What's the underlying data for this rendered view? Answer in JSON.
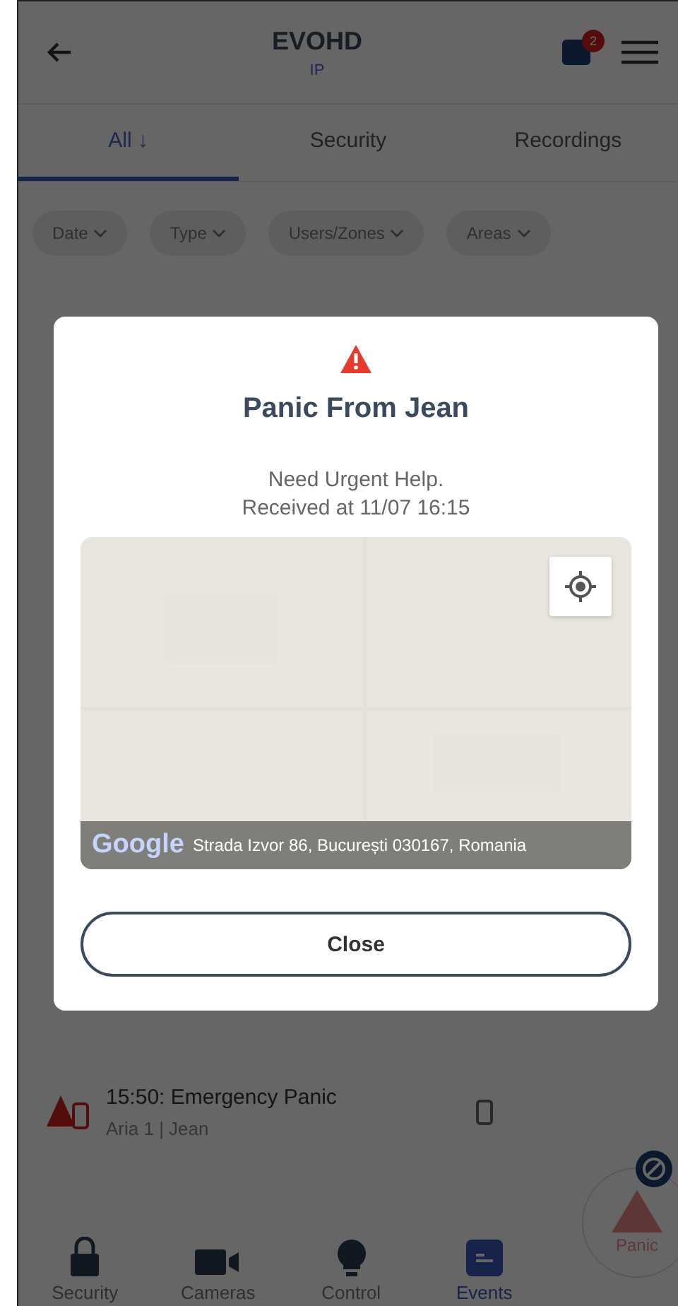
{
  "header": {
    "title": "EVOHD",
    "subtitle": "IP",
    "notification_count": "2"
  },
  "tabs": [
    {
      "label": "All ↓",
      "selected": true
    },
    {
      "label": "Security",
      "selected": false
    },
    {
      "label": "Recordings",
      "selected": false
    }
  ],
  "filters": [
    "Date",
    "Type",
    "Users/Zones",
    "Areas"
  ],
  "events": [
    {
      "title": "15:50: Emergency Panic",
      "detail": "Aria 1 | Jean"
    }
  ],
  "bottom_nav": [
    {
      "label": "Security",
      "kind": "lock",
      "selected": false
    },
    {
      "label": "Cameras",
      "kind": "camera",
      "selected": false
    },
    {
      "label": "Control",
      "kind": "bulb",
      "selected": false
    },
    {
      "label": "Events",
      "kind": "list",
      "selected": true
    }
  ],
  "panic_button": {
    "label": "Panic"
  },
  "dialog": {
    "title": "Panic From Jean",
    "message": "Need Urgent Help.",
    "received": "Received at 11/07 16:15",
    "map": {
      "brand": "Google",
      "address": "Strada Izvor 86, București 030167, Romania"
    },
    "close_button": "Close"
  }
}
